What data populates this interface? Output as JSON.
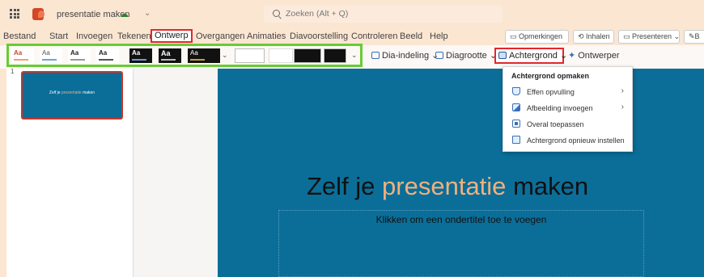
{
  "titlebar": {
    "doc_title": "presentatie maken",
    "search_placeholder": "Zoeken (Alt + Q)"
  },
  "menu": {
    "items": [
      "Bestand",
      "Start",
      "Invoegen",
      "Tekenen",
      "Ontwerp",
      "Overgangen",
      "Animaties",
      "Diavoorstelling",
      "Controleren",
      "Beeld",
      "Help"
    ],
    "active": "Ontwerp"
  },
  "right_buttons": {
    "comments": "Opmerkingen",
    "catchup": "Inhalen",
    "present": "Presenteren",
    "edit": "B"
  },
  "ribbon": {
    "theme_label": "Aa",
    "dia_indeling": "Dia-indeling",
    "diagrootte": "Diagrootte",
    "achtergrond": "Achtergrond",
    "ontwerper": "Ontwerper"
  },
  "dropdown": {
    "header": "Achtergrond opmaken",
    "items": [
      {
        "label": "Effen opvulling",
        "has_submenu": true
      },
      {
        "label": "Afbeelding invoegen",
        "has_submenu": true
      },
      {
        "label": "Overal toepassen",
        "has_submenu": false
      },
      {
        "label": "Achtergrond opnieuw instellen",
        "has_submenu": false
      }
    ]
  },
  "thumbnail": {
    "slide_number": "1",
    "text_dark": "Zelf je",
    "text_accent": "presentatie",
    "text_end": "maken"
  },
  "slide": {
    "title_dark": "Zelf je",
    "title_accent": "presentatie",
    "title_end": "maken",
    "subtitle_placeholder": "Klikken om een ondertitel toe te voegen"
  },
  "colors": {
    "slide_background": "#0b6e99",
    "accent_text": "#f2b07b",
    "highlight_red": "#e4262c",
    "highlight_green": "#66cc33"
  }
}
